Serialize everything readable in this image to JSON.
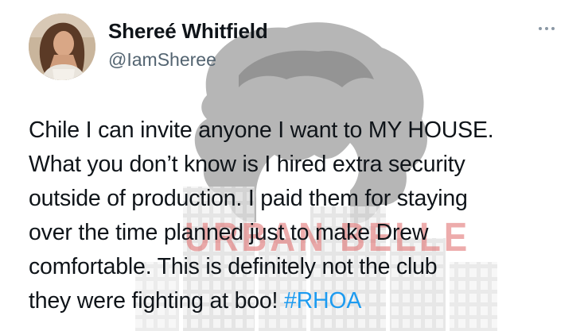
{
  "user": {
    "display_name": "Shereé Whitfield",
    "handle": "@IamSheree"
  },
  "watermark": {
    "text": "URBAN BELLE"
  },
  "tweet": {
    "lines": [
      "Chile I can invite anyone I want to MY HOUSE.",
      "What you don’t know is I hired extra security",
      "outside of production. I paid them for staying",
      "over the time planned just to make Drew",
      "comfortable. This is definitely not the club",
      "they were fighting at boo! "
    ],
    "hashtag": "#RHOA"
  },
  "icons": {
    "more": "more-horizontal-icon",
    "avatar": "profile-photo"
  },
  "colors": {
    "text": "#0f1419",
    "secondary": "#536471",
    "hashtag": "#1d9bf0",
    "watermark_red": "#e06a6a"
  }
}
